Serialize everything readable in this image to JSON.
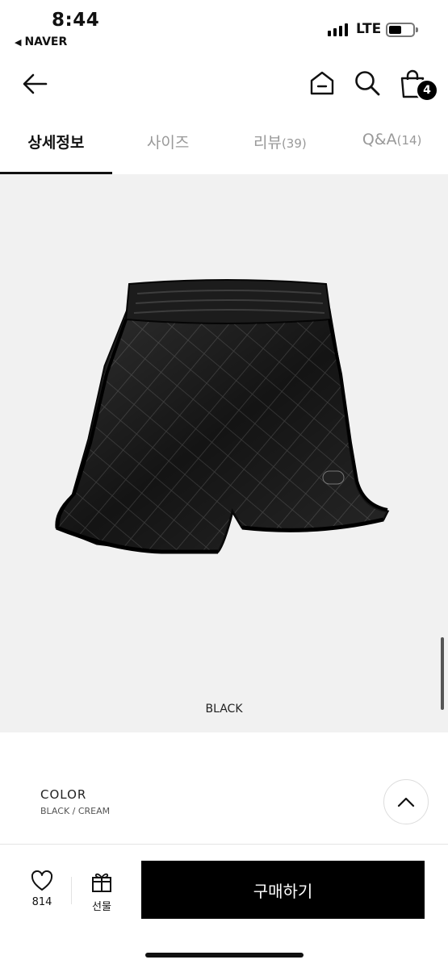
{
  "status_bar": {
    "time": "8:44",
    "back_app": "NAVER",
    "network": "LTE"
  },
  "header": {
    "cart_count": "4"
  },
  "tabs": [
    {
      "label": "상세정보",
      "count": "",
      "active": true
    },
    {
      "label": "사이즈",
      "count": "",
      "active": false
    },
    {
      "label": "리뷰",
      "count": "(39)",
      "active": false
    },
    {
      "label": "Q&A",
      "count": "(14)",
      "active": false
    }
  ],
  "product": {
    "image_caption": "BLACK"
  },
  "option": {
    "label": "COLOR",
    "values": "BLACK / CREAM"
  },
  "bottom_bar": {
    "like_count": "814",
    "gift_label": "선물",
    "buy_label": "구매하기"
  },
  "colors": {
    "accent": "#000000",
    "image_bg": "#f1f1f1",
    "inactive_tab": "#999999"
  }
}
